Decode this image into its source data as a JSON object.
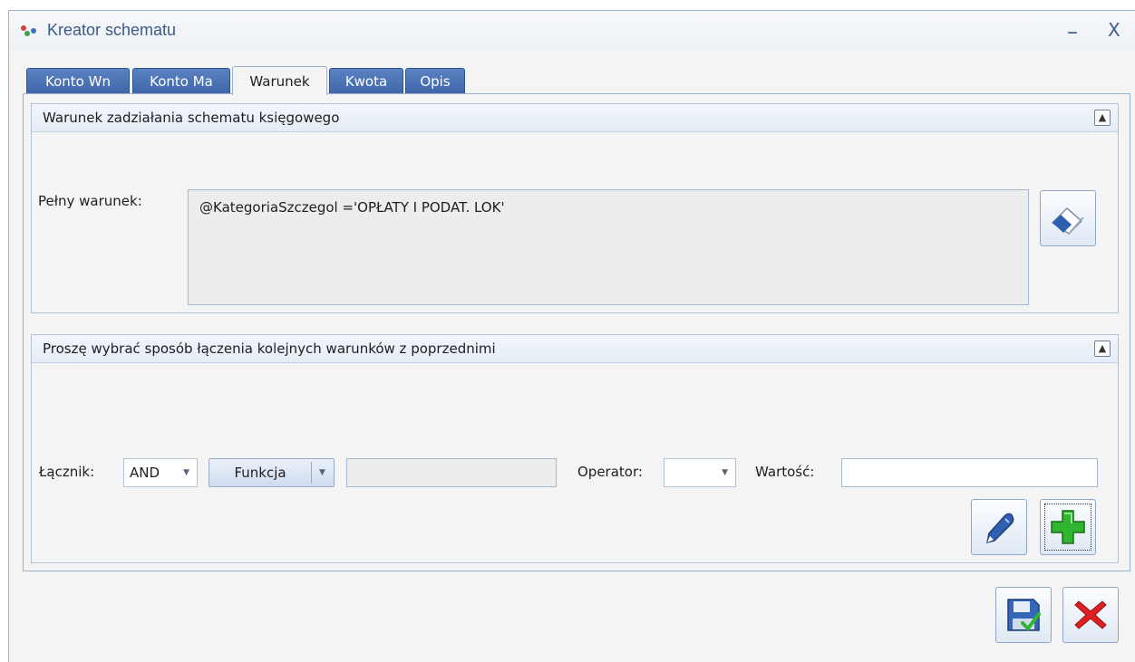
{
  "window": {
    "title": "Kreator schematu",
    "minimize": "–",
    "close": "X"
  },
  "tabs": [
    {
      "label": "Konto Wn"
    },
    {
      "label": "Konto Ma"
    },
    {
      "label": "Warunek"
    },
    {
      "label": "Kwota"
    },
    {
      "label": "Opis"
    }
  ],
  "active_tab": "Warunek",
  "group1": {
    "title": "Warunek zadziałania schematu księgowego",
    "full_condition_label": "Pełny warunek:",
    "full_condition_value": "@KategoriaSzczegol ='OPŁATY I PODAT. LOK'"
  },
  "group2": {
    "title": "Proszę wybrać sposób łączenia kolejnych warunków z poprzednimi",
    "connector_label": "Łącznik:",
    "connector_value": "AND",
    "function_label": "Funkcja",
    "operator_label": "Operator:",
    "operator_value": "",
    "value_label": "Wartość:",
    "value_value": ""
  },
  "colors": {
    "tab_blue": "#4a72b4",
    "accent_green": "#2fb52f",
    "close_red": "#e02020"
  },
  "icons": [
    "app-icon",
    "eraser-icon",
    "edit-pen-icon",
    "add-plus-icon",
    "save-icon",
    "cancel-x-icon",
    "collapse-chevron-icon"
  ]
}
